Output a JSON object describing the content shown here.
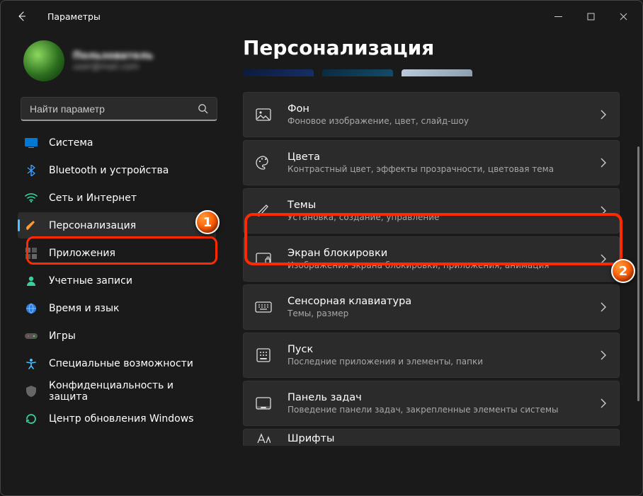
{
  "window": {
    "title": "Параметры"
  },
  "user": {
    "name": "Пользователь",
    "email": "user@mail.com"
  },
  "search": {
    "placeholder": "Найти параметр"
  },
  "sidebar": {
    "items": [
      {
        "label": "Система"
      },
      {
        "label": "Bluetooth и устройства"
      },
      {
        "label": "Сеть и Интернет"
      },
      {
        "label": "Персонализация"
      },
      {
        "label": "Приложения"
      },
      {
        "label": "Учетные записи"
      },
      {
        "label": "Время и язык"
      },
      {
        "label": "Игры"
      },
      {
        "label": "Специальные возможности"
      },
      {
        "label": "Конфиденциальность и защита"
      },
      {
        "label": "Центр обновления Windows"
      }
    ],
    "selected_index": 3
  },
  "page": {
    "title": "Персонализация"
  },
  "cards": [
    {
      "title": "Фон",
      "sub": "Фоновое изображение, цвет, слайд-шоу"
    },
    {
      "title": "Цвета",
      "sub": "Контрастный цвет, эффекты прозрачности, цветовая тема"
    },
    {
      "title": "Темы",
      "sub": "Установка, создание, управление"
    },
    {
      "title": "Экран блокировки",
      "sub": "Изображения экрана блокировки, приложения, анимация"
    },
    {
      "title": "Сенсорная клавиатура",
      "sub": "Темы, размер"
    },
    {
      "title": "Пуск",
      "sub": "Последние приложения и элементы, папки"
    },
    {
      "title": "Панель задач",
      "sub": "Поведение панели задач, закрепленные элементы системы"
    },
    {
      "title": "Шрифты",
      "sub": ""
    }
  ],
  "annotations": {
    "badge1": "1",
    "badge2": "2"
  },
  "colors": {
    "accent": "#4cc2ff",
    "highlight": "#ff2a00"
  }
}
